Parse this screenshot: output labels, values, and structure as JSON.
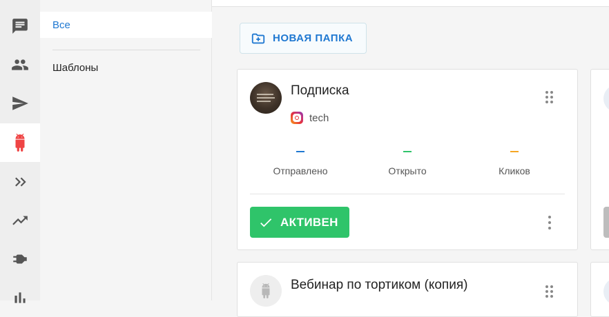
{
  "rail": {
    "items": [
      {
        "icon": "chat-icon"
      },
      {
        "icon": "people-icon"
      },
      {
        "icon": "send-icon"
      },
      {
        "icon": "android-bot-icon",
        "active": true
      },
      {
        "icon": "double-chevron-icon"
      },
      {
        "icon": "trending-up-icon"
      },
      {
        "icon": "plug-icon"
      },
      {
        "icon": "bar-chart-icon"
      }
    ]
  },
  "subnav": {
    "items": [
      {
        "label": "Все",
        "active": true
      },
      {
        "label": "Шаблоны",
        "active": false
      }
    ]
  },
  "toolbar": {
    "new_folder_label": "НОВАЯ ПАПКА"
  },
  "cards": [
    {
      "title": "Подписка",
      "channel": {
        "icon": "instagram-icon",
        "name": "tech"
      },
      "stats": [
        {
          "label": "Отправлено",
          "value": "—",
          "color": "#1f78d1"
        },
        {
          "label": "Открыто",
          "value": "—",
          "color": "#2fc46a"
        },
        {
          "label": "Кликов",
          "value": "—",
          "color": "#f5a623"
        }
      ],
      "status_label": "АКТИВЕН",
      "status_color": "#2fc46a"
    },
    {
      "title": "Вебинар по тортиком (копия)"
    }
  ],
  "colors": {
    "accent": "#1f78d1",
    "active_icon": "#ef4444",
    "rail_icon": "#555555"
  }
}
